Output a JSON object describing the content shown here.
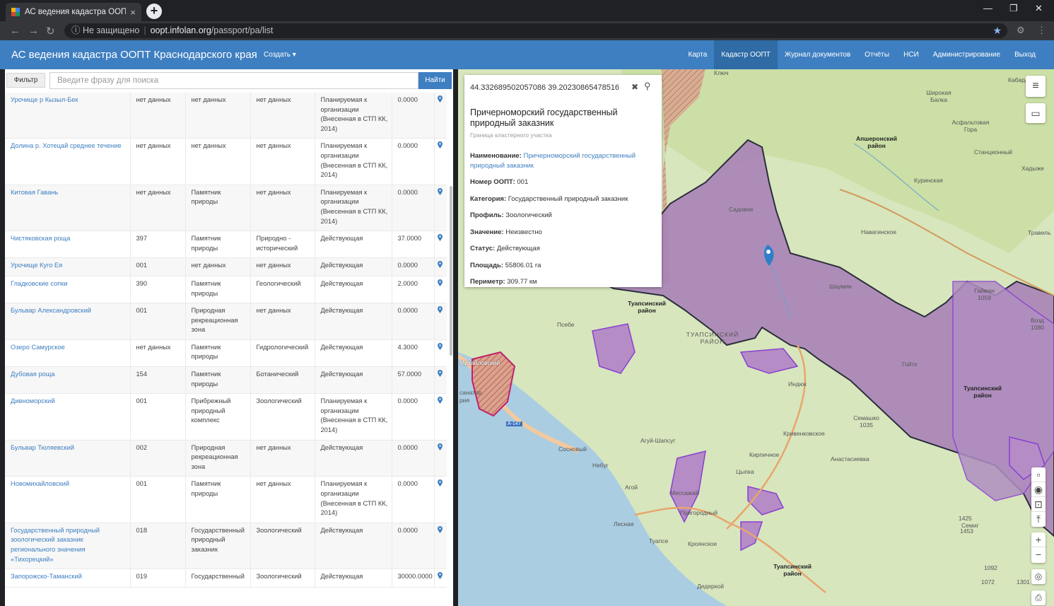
{
  "browser": {
    "tab_title": "АС ведения кадастра ООПТ Крас",
    "tab_close": "×",
    "new_tab": "+",
    "security": "Не защищено",
    "url_host": "oopt.infolan.org",
    "url_path": "/passport/pa/list",
    "back": "←",
    "forward": "→",
    "reload": "↻",
    "info": "ⓘ",
    "star": "★",
    "minimize": "—",
    "restore": "❐",
    "close": "✕",
    "ext": "⚙",
    "more": "⋮"
  },
  "app": {
    "brand": "АС ведения кадастра ООПТ Краснодарского края",
    "create": "Создать ▾",
    "menu": [
      {
        "label": "Карта",
        "active": false
      },
      {
        "label": "Кадастр ООПТ",
        "active": true
      },
      {
        "label": "Журнал документов",
        "active": false
      },
      {
        "label": "Отчёты",
        "active": false
      },
      {
        "label": "НСИ",
        "active": false
      },
      {
        "label": "Администрирование",
        "active": false
      },
      {
        "label": "Выход",
        "active": false
      }
    ]
  },
  "list": {
    "filter_label": "Фильтр",
    "search_placeholder": "Введите фразу для поиска",
    "search_button": "Найти",
    "rows": [
      {
        "name": "Урочище р Кызыл-Бек",
        "number": "нет данных",
        "category": "нет данных",
        "profile": "нет данных",
        "status": "Планируемая к организации (Внесенная в СТП КК, 2014)",
        "area": "0.0000"
      },
      {
        "name": "Долина р. Хотецай среднее течение",
        "number": "нет данных",
        "category": "нет данных",
        "profile": "нет данных",
        "status": "Планируемая к организации (Внесенная в СТП КК, 2014)",
        "area": "0.0000"
      },
      {
        "name": "Китовая Гавань",
        "number": "нет данных",
        "category": "Памятник природы",
        "profile": "нет данных",
        "status": "Планируемая к организации (Внесенная в СТП КК, 2014)",
        "area": "0.0000"
      },
      {
        "name": "Чистяковская роща",
        "number": "397",
        "category": "Памятник природы",
        "profile": "Природно - исторический",
        "status": "Действующая",
        "area": "37.0000"
      },
      {
        "name": "Урочище Куго Ея",
        "number": "001",
        "category": "нет данных",
        "profile": "нет данных",
        "status": "Действующая",
        "area": "0.0000"
      },
      {
        "name": "Гладковские сопки",
        "number": "390",
        "category": "Памятник природы",
        "profile": "Геологический",
        "status": "Действующая",
        "area": "2.0000"
      },
      {
        "name": "Бульвар Александровский",
        "number": "001",
        "category": "Природная рекреационная зона",
        "profile": "нет данных",
        "status": "Действующая",
        "area": "0.0000"
      },
      {
        "name": "Озеро Самурское",
        "number": "нет данных",
        "category": "Памятник природы",
        "profile": "Гидрологический",
        "status": "Действующая",
        "area": "4.3000"
      },
      {
        "name": "Дубовая роща",
        "number": "154",
        "category": "Памятник природы",
        "profile": "Ботанический",
        "status": "Действующая",
        "area": "57.0000"
      },
      {
        "name": "Дивноморский",
        "number": "001",
        "category": "Прибрежный природный комплекс",
        "profile": "Зоологический",
        "status": "Планируемая к организации (Внесенная в СТП КК, 2014)",
        "area": "0.0000"
      },
      {
        "name": "Бульвар Тюляевский",
        "number": "002",
        "category": "Природная рекреационная зона",
        "profile": "нет данных",
        "status": "Действующая",
        "area": "0.0000"
      },
      {
        "name": "Новомихайловский",
        "number": "001",
        "category": "Памятник природы",
        "profile": "нет данных",
        "status": "Планируемая к организации (Внесенная в СТП КК, 2014)",
        "area": "0.0000"
      },
      {
        "name": "Государственный природный зоологический заказник регионального значения «Тихорецкий»",
        "number": "018",
        "category": "Государственный природный заказник",
        "profile": "Зоологический",
        "status": "Действующая",
        "area": "0.0000"
      },
      {
        "name": "Запорожско-Таманский",
        "number": "019",
        "category": "Государственный",
        "profile": "Зоологический",
        "status": "Действующая",
        "area": "30000.0000"
      }
    ]
  },
  "popup": {
    "coords": "44.332689502057086 39.20230865478516",
    "close": "✖",
    "search": "⚲",
    "title": "Причерноморский государственный природный заказник",
    "subtitle": "Граница кластерного участка",
    "fields": [
      {
        "label": "Наименование:",
        "value": "Причерноморский государственный природный заказник",
        "link": true
      },
      {
        "label": "Номер ООПТ:",
        "value": "001",
        "link": false
      },
      {
        "label": "Категория:",
        "value": "Государственный природный заказник",
        "link": false
      },
      {
        "label": "Профиль:",
        "value": "Зоологический",
        "link": false
      },
      {
        "label": "Значение:",
        "value": "Неизвестно",
        "link": false
      },
      {
        "label": "Статус:",
        "value": "Действующая",
        "link": false
      },
      {
        "label": "Площадь:",
        "value": "55806.01 га",
        "link": false
      },
      {
        "label": "Периметр:",
        "value": "309.77 км",
        "link": false
      }
    ]
  },
  "map": {
    "labels": {
      "kabardinsk": "Кабардинка",
      "shirokaya": "Широкая Балка",
      "asfalt": "Асфальтовая Гора",
      "apsheron": "Апшеронский район",
      "stantsionny": "Станционный",
      "khadyzh": "Хадыже",
      "kurinskaya": "Куринская",
      "navaginskoe": "Навагинское",
      "travel": "Травель",
      "sadovoe": "Садовое",
      "shaumyan": "Шаумян",
      "tuapse_r1": "Туапсинский район",
      "tuapse_big": "ТУАПСИНСКИЙ РАЙОН",
      "psebe": "Псебе",
      "goyth": "Гойтх",
      "indyuk": "Индюк",
      "tuapse_r2": "Туапсинский район",
      "krivenkovskoe": "Кривенковское",
      "agui": "Агуй-Шапсуг",
      "sosnovy": "Сосновый",
      "nebug": "Небуг",
      "kirpichnoe": "Кирпичное",
      "anastasievka": "Анастасиевка",
      "tsypka": "Цыпка",
      "agoi": "Агой",
      "lesnaya": "Лесная",
      "messazhay": "Мессажай",
      "prigorodny": "Пригородный",
      "tuapse": "Туапсе",
      "krasnodonsk": "Кроянское",
      "tuapse_r3": "Туапсинский район",
      "derekoy": "Дедеркой",
      "mikhaylovsky": "Михайловский",
      "sanatory": "санатор",
      "ria": "рия",
      "a147": "А-147",
      "klyuch": "Ключ",
      "gaiman": "Гайман 1059",
      "semashko": "Семашко 1035",
      "vozd": "Возд 1080",
      "hill1092": "1092",
      "hill1072": "1072",
      "hill1425": "1425",
      "hill1453": "1453",
      "hill1301": "1301",
      "tunnel": "Туннель",
      "semi": "Семиг"
    },
    "controls": {
      "layers": "≡",
      "draw": "▭",
      "zoom_in": "+",
      "zoom_out": "−",
      "locate": "◎",
      "print": "⎙",
      "tool1": "▫",
      "tool2": "◉",
      "tool3": "⊡",
      "tool4": "⤒"
    },
    "colors": {
      "forest": "#cfe0ad",
      "sea": "#a9cce3",
      "reserve": "#a97fb6",
      "pin": "#2e7fc8"
    }
  }
}
